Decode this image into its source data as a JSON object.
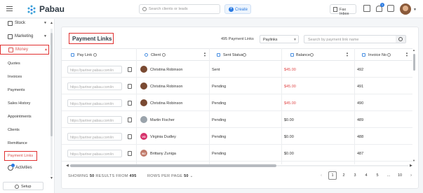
{
  "header": {
    "brand": "Pabau",
    "search_placeholder": "Search clients or leads",
    "create_label": "Create",
    "fax_label": "Fax Inbox",
    "notification_count": "1"
  },
  "sidebar": {
    "stock": "Stock",
    "marketing": "Marketing",
    "money": "Money",
    "sub_items": [
      "Quotes",
      "Invoices",
      "Payments",
      "Sales History",
      "Appointments",
      "Clients",
      "Remittance"
    ],
    "active_item": "Payment Links",
    "activities": "Activities",
    "setup": "Setup"
  },
  "page": {
    "title": "Payment Links",
    "count_text": "495 Payment Links",
    "filter_value": "Paylinks",
    "search_placeholder": "Search by payment link name"
  },
  "table": {
    "columns": [
      "Pay Link",
      "Client",
      "Sent Status",
      "Balance",
      "Invoice No"
    ],
    "rows": [
      {
        "link": "https://partner.pabau.com/in",
        "initials": "",
        "avatar_color": "#7a4a32",
        "client": "Christina Robinson",
        "status": "Sent",
        "balance": "$45.00",
        "balance_color": "#e04848",
        "invoice": "492"
      },
      {
        "link": "https://partner.pabau.com/in",
        "initials": "",
        "avatar_color": "#7a4a32",
        "client": "Christina Robinson",
        "status": "Pending",
        "balance": "$45.00",
        "balance_color": "#e04848",
        "invoice": "491"
      },
      {
        "link": "https://partner.pabau.com/in",
        "initials": "",
        "avatar_color": "#7a4a32",
        "client": "Christina Robinson",
        "status": "Pending",
        "balance": "$45.00",
        "balance_color": "#e04848",
        "invoice": "490"
      },
      {
        "link": "https://partner.pabau.com/in",
        "initials": "",
        "avatar_color": "#9aa3ab",
        "client": "Martin Fischer",
        "status": "Pending",
        "balance": "$0.00",
        "balance_color": "#333333",
        "invoice": "489"
      },
      {
        "link": "https://partner.pabau.com/in",
        "initials": "VD",
        "avatar_color": "#d6336c",
        "client": "Virginia Dudley",
        "status": "Pending",
        "balance": "$0.00",
        "balance_color": "#333333",
        "invoice": "488"
      },
      {
        "link": "https://partner.pabau.com/in",
        "initials": "BZ",
        "avatar_color": "#c07a6a",
        "client": "Brittany Zuniga",
        "status": "Pending",
        "balance": "$0.00",
        "balance_color": "#333333",
        "invoice": "487"
      }
    ]
  },
  "footer": {
    "showing_prefix": "SHOWING",
    "showing_count": "50",
    "showing_mid": "RESULTS FROM",
    "showing_total": "495",
    "rows_prefix": "ROWS PER PAGE",
    "rows_value": "50",
    "pages": [
      "1",
      "2",
      "3",
      "4",
      "5",
      "...",
      "10"
    ],
    "current_page": "1"
  },
  "colors": {
    "accent": "#2a7ae2",
    "highlight_border": "#e03030",
    "negative_balance": "#e04848"
  }
}
